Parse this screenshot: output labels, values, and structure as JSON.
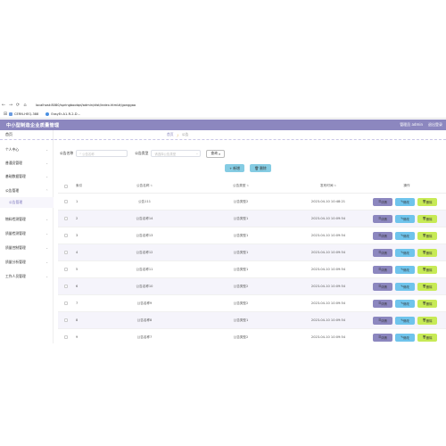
{
  "browser": {
    "url": "localhost:8080/springbootqd/admin/dist/index.html#/gonggao",
    "nav_icons": [
      "←",
      "→",
      "⟳",
      "⌂"
    ],
    "bookmarks": [
      {
        "label": "CERN-HEQ-388",
        "color": "#6a9be0"
      },
      {
        "label": "EasyEr-A1-R-2-D...",
        "color": "#4a90e2"
      }
    ]
  },
  "header": {
    "title": "中小型制造企业质量管理",
    "user": "管理员 admin",
    "logout": "退出登录"
  },
  "sidebar": {
    "home": "首页",
    "items": [
      {
        "label": "个人中心",
        "chevron": "⌄"
      },
      {
        "label": "普通员管理",
        "chevron": "⌄"
      },
      {
        "label": "基础数据管理",
        "chevron": "⌄"
      },
      {
        "label": "公告管理",
        "chevron": "⌃"
      },
      {
        "label": "公告管理",
        "chevron": ""
      },
      {
        "label": "物料检测管理",
        "chevron": "⌄"
      },
      {
        "label": "质量检测管理",
        "chevron": "⌄"
      },
      {
        "label": "质量控制管理",
        "chevron": "⌄"
      },
      {
        "label": "质量分析管理",
        "chevron": "⌄"
      },
      {
        "label": "工作人员管理",
        "chevron": "⌄"
      }
    ]
  },
  "breadcrumb": {
    "home": "首页",
    "separator": "/",
    "current": "公告"
  },
  "search": {
    "name_label": "公告名称",
    "name_placeholder": "公告名称",
    "type_label": "公告类型",
    "type_placeholder": "请选择公告类型",
    "search_button": "查询"
  },
  "actions": {
    "add": "新增",
    "delete": "删除"
  },
  "table": {
    "headers": {
      "index": "索引",
      "name": "公告名称",
      "type": "公告类型",
      "date": "发布时间",
      "ops": "操作"
    },
    "op_labels": {
      "detail": "详情",
      "edit": "修改",
      "delete": "删除"
    },
    "rows": [
      {
        "index": "1",
        "name": "公告111",
        "type": "公告类型2",
        "date": "2023-04-10 10:48:21"
      },
      {
        "index": "2",
        "name": "公告名称14",
        "type": "公告类型1",
        "date": "2023-04-10 10:09:54"
      },
      {
        "index": "3",
        "name": "公告名称13",
        "type": "公告类型1",
        "date": "2023-04-10 10:09:54"
      },
      {
        "index": "4",
        "name": "公告名称12",
        "type": "公告类型1",
        "date": "2023-04-10 10:09:54"
      },
      {
        "index": "5",
        "name": "公告名称11",
        "type": "公告类型1",
        "date": "2023-04-10 10:09:54"
      },
      {
        "index": "6",
        "name": "公告名称10",
        "type": "公告类型2",
        "date": "2023-04-10 10:09:54"
      },
      {
        "index": "7",
        "name": "公告名称9",
        "type": "公告类型2",
        "date": "2023-04-10 10:09:54"
      },
      {
        "index": "8",
        "name": "公告名称8",
        "type": "公告类型1",
        "date": "2023-04-10 10:09:54"
      },
      {
        "index": "9",
        "name": "公告名称7",
        "type": "公告类型2",
        "date": "2023-04-10 10:09:54"
      }
    ]
  },
  "colors": {
    "header": "#8c87bf",
    "detail_button": "#8c87bf",
    "edit_button": "#6fc4ec",
    "delete_button": "#c7ea56",
    "toolbar_button": "#85cce3"
  }
}
